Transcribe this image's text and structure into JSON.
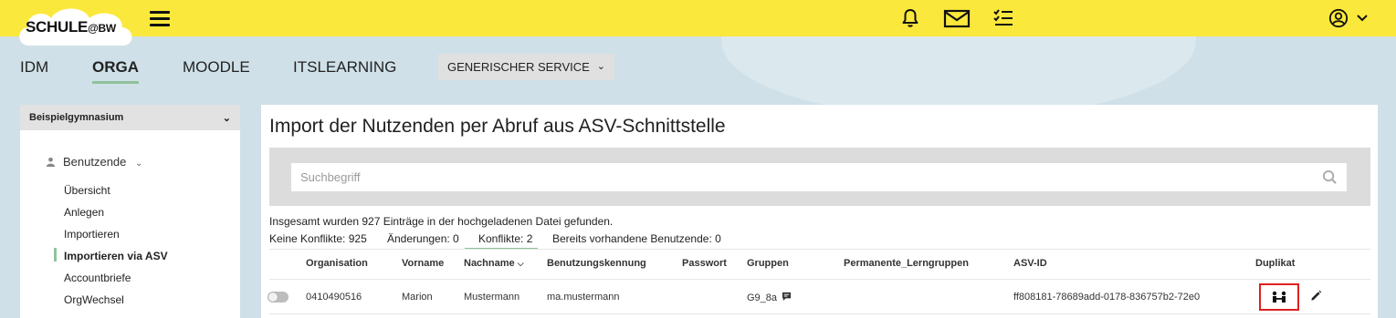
{
  "brand": {
    "logo_main": "SCHULE",
    "logo_suffix": "@BW",
    "bar_color": "#fbe83c",
    "accent_color": "#8fc39a"
  },
  "topbar": {
    "icons": [
      "menu-icon",
      "bell-icon",
      "mail-icon",
      "task-list-icon",
      "account-icon",
      "chevron-down-icon"
    ]
  },
  "nav": {
    "items": [
      "IDM",
      "ORGA",
      "MOODLE",
      "ITSLEARNING"
    ],
    "active": "ORGA",
    "service_select": "GENERISCHER SERVICE"
  },
  "sidebar": {
    "school": "Beispielgymnasium",
    "section": "Benutzende",
    "links": [
      "Übersicht",
      "Anlegen",
      "Importieren",
      "Importieren via ASV",
      "Accountbriefe",
      "OrgWechsel"
    ],
    "active_link": "Importieren via ASV"
  },
  "main": {
    "title": "Import der Nutzenden per Abruf aus ASV-Schnittstelle",
    "search_placeholder": "Suchbegriff",
    "info": "Insgesamt wurden 927 Einträge in der hochgeladenen Datei gefunden.",
    "filters": [
      "Keine Konflikte: 925",
      "Änderungen: 0",
      "Konflikte: 2",
      "Bereits vorhandene Benutzende: 0"
    ],
    "active_filter": "Konflikte: 2",
    "table": {
      "columns": [
        "Organisation",
        "Vorname",
        "Nachname",
        "Benutzungskennung",
        "Passwort",
        "Gruppen",
        "Permanente_Lerngruppen",
        "ASV-ID",
        "Duplikat"
      ],
      "sorted_column": "Nachname",
      "rows": [
        {
          "organisation": "0410490516",
          "vorname": "Marion",
          "nachname": "Mustermann",
          "kennung": "ma.mustermann",
          "passwort": "",
          "gruppen": "G9_8a",
          "permanente_lerngruppen": "",
          "asv_id": "ff808181-78689add-0178-836757b2-72e0"
        }
      ]
    }
  }
}
